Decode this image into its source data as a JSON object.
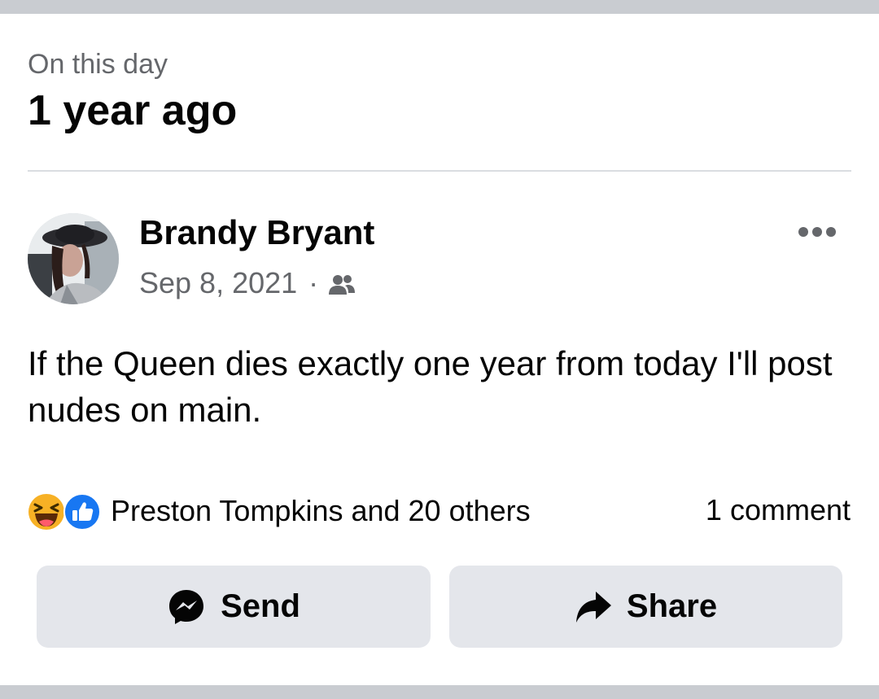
{
  "memory": {
    "subtitle": "On this day",
    "title": "1 year ago"
  },
  "post": {
    "author": "Brandy Bryant",
    "date": "Sep 8, 2021",
    "separator": "·",
    "audience_icon": "friends-icon",
    "more_icon": "more-options-icon",
    "text": "If the Queen dies exactly one year from today I'll post nudes on main."
  },
  "engagement": {
    "reaction_icons": [
      "haha-reaction-icon",
      "like-reaction-icon"
    ],
    "reactors": "Preston Tompkins and 20 others",
    "comments": "1 comment"
  },
  "actions": {
    "send_label": "Send",
    "send_icon": "messenger-icon",
    "share_label": "Share",
    "share_icon": "share-arrow-icon"
  },
  "colors": {
    "separator_bar": "#c9ccd1",
    "secondary_text": "#65676b",
    "button_bg": "#e4e6eb",
    "like_blue": "#1877f2",
    "haha_yellow": "#f7b125"
  }
}
